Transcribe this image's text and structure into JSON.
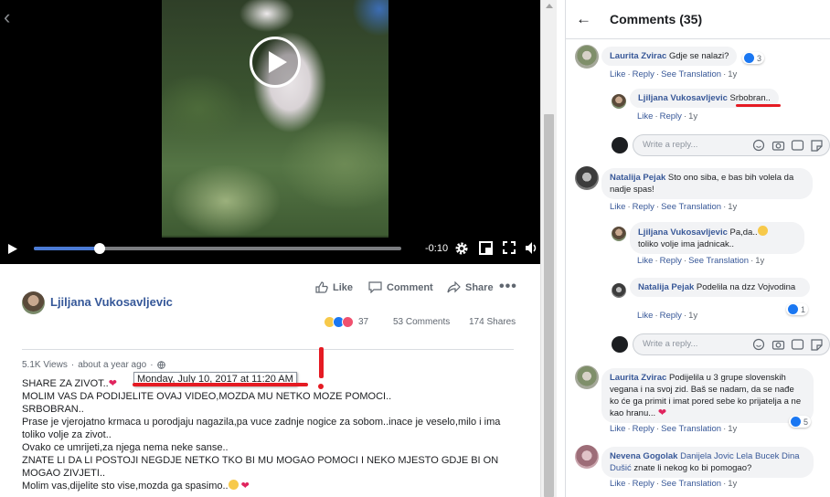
{
  "video": {
    "time_remaining": "-0:10",
    "progress": 0.18,
    "icons": [
      "play-icon",
      "settings-icon",
      "picture-in-picture-icon",
      "fullscreen-icon",
      "volume-icon"
    ]
  },
  "post": {
    "author": "Ljiljana Vukosavljevic",
    "actions": {
      "like": "Like",
      "comment": "Comment",
      "share": "Share"
    },
    "reactions_count": "37",
    "comments_count": "53 Comments",
    "shares_count": "174 Shares",
    "views": "5.1K Views",
    "time_ago": "about a year ago",
    "dot": "·",
    "tooltip_date": "Monday, July 10, 2017 at 11:20 AM",
    "text_lines": [
      "SHARE ZA ZIVOT..",
      "MOLIM VAS DA PODIJELITE OVAJ VIDEO,MOZDA MU NETKO MOZE POMOCI..",
      "SRBOBRAN..",
      "Prase je vjerojatno krmaca u porodjaju nagazila,pa vuce zadnje nogice za sobom..inace je veselo,milo i ima toliko volje za zivot..",
      "Ovako ce umrijeti,za njega nema neke sanse..",
      "ZNATE LI DA LI POSTOJI NEGDJE NETKO TKO BI MU MOGAO POMOCI I NEKO MJESTO GDJE BI ON MOGAO ZIVJETI..",
      "Molim vas,dijelite sto vise,mozda ga spasimo.."
    ]
  },
  "comments_panel": {
    "title": "Comments (35)",
    "reply_placeholder": "Write a reply...",
    "like": "Like",
    "reply": "Reply",
    "see_translation": "See Translation",
    "time": "1y",
    "c1": {
      "name": "Laurita Zvirac",
      "text": "Gdje se nalazi?",
      "likes": "3"
    },
    "c1r1": {
      "name": "Ljiljana Vukosavljevic",
      "text": "Srbobran.."
    },
    "c2": {
      "name": "Natalija Pejak",
      "text": "Sto ono siba, e bas bih volela da nadje spas!"
    },
    "c2r1": {
      "name": "Ljiljana Vukosavljevic",
      "text": "Pa,da..",
      "text2": "toliko volje ima jadnicak.."
    },
    "c2r2": {
      "name": "Natalija Pejak",
      "text": "Podelila na dzz Vojvodina",
      "likes": "1"
    },
    "c3": {
      "name": "Laurita Zvirac",
      "text": "Podijelila u 3 grupe slovenskih vegana i na svoj zid. Baš se nadam, da se nađe ko će ga primit i imat pored sebe ko prijatelja a ne kao hranu...",
      "likes": "5"
    },
    "c4": {
      "name": "Nevena Gogolak",
      "tags": "Danijela Jovic Lela Bucek Dina Dušić",
      "text": "znate li nekog ko bi pomogao?"
    }
  }
}
